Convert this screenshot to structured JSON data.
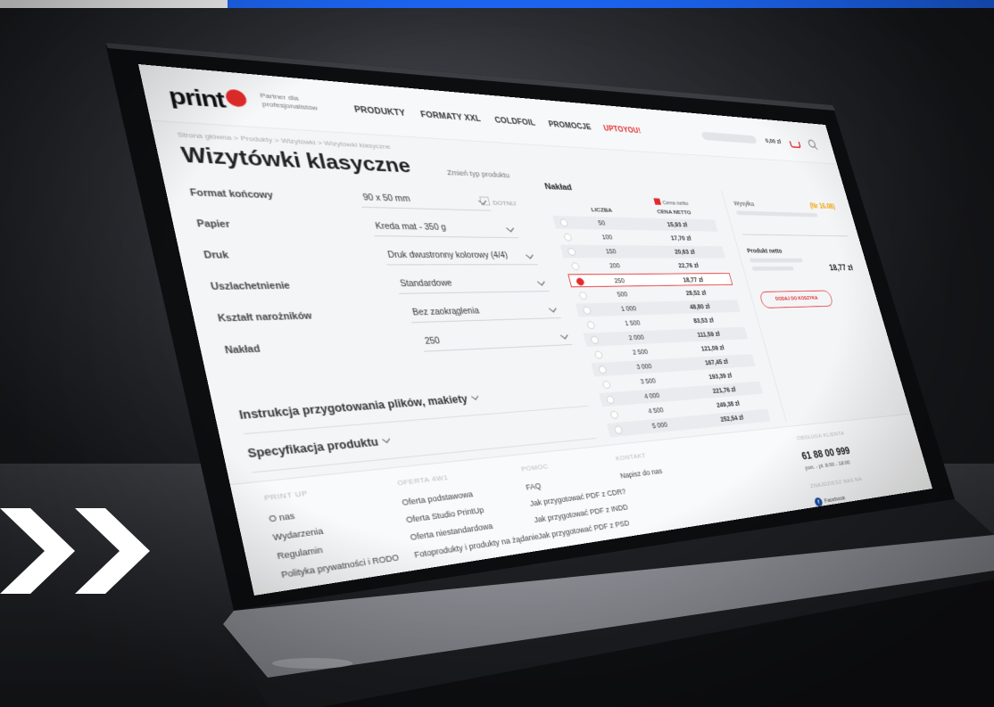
{
  "brand": {
    "logo": "print",
    "tagline": "Partner dla profesjonalistów",
    "accent": "#e32b2b",
    "strip_blue": "#1e6bff"
  },
  "nav": {
    "items": [
      "PRODUKTY",
      "FORMATY XXL",
      "COLDFOIL",
      "PROMOCJE"
    ],
    "highlight": "UPTOYOU!"
  },
  "header": {
    "cart_total": "0,00 zł",
    "icons": [
      "cart-icon",
      "search-icon"
    ]
  },
  "page": {
    "breadcrumbs": "Strona główna > Produkty > Wizytówki > Wizytówki klasyczne",
    "title": "Wizytówki klasyczne",
    "change_type": "Zmień typ produktu"
  },
  "form": {
    "rows": [
      {
        "label": "Format końcowy",
        "value": "90 x 50 mm"
      },
      {
        "label": "Papier",
        "value": "Kreda mat - 350 g"
      },
      {
        "label": "Druk",
        "value": "Druk dwustronny kolorowy (4/4)"
      },
      {
        "label": "Uszlachetnienie",
        "value": "Standardowe"
      },
      {
        "label": "Kształt narożników",
        "value": "Bez zaokrąglenia"
      },
      {
        "label": "Nakład",
        "value": "250"
      }
    ],
    "dotnij_label": "DOTNIJ"
  },
  "accordions": {
    "instructions": "Instrukcja przygotowania plików, makiety",
    "spec": "Specyfikacja produktu"
  },
  "naklad": {
    "title": "Nakład",
    "cena_netto_label": "Cena netto",
    "col_qty": "LICZBA",
    "col_price": "CENA NETTO",
    "selected_index": 4,
    "rows": [
      {
        "qty": "50",
        "price": "15,93 zł"
      },
      {
        "qty": "100",
        "price": "17,70 zł"
      },
      {
        "qty": "150",
        "price": "20,63 zł"
      },
      {
        "qty": "200",
        "price": "22,76 zł"
      },
      {
        "qty": "250",
        "price": "18,77 zł"
      },
      {
        "qty": "500",
        "price": "28,52 zł"
      },
      {
        "qty": "1 000",
        "price": "48,80 zł"
      },
      {
        "qty": "1 500",
        "price": "83,53 zł"
      },
      {
        "qty": "2 000",
        "price": "111,59 zł"
      },
      {
        "qty": "2 500",
        "price": "121,09 zł"
      },
      {
        "qty": "3 000",
        "price": "167,45 zł"
      },
      {
        "qty": "3 500",
        "price": "193,39 zł"
      },
      {
        "qty": "4 000",
        "price": "221,76 zł"
      },
      {
        "qty": "4 500",
        "price": "249,38 zł"
      },
      {
        "qty": "5 000",
        "price": "252,54 zł"
      }
    ]
  },
  "summary": {
    "shipping_label": "Wysyłka",
    "shipping_price": "(Nr 16.08)",
    "netto_label": "Produkt netto",
    "netto_value": "18,77 zł",
    "add_button": "DODAJ DO KOSZYKA"
  },
  "footer": {
    "columns": [
      {
        "heading": "PRINT UP",
        "items": [
          "O nas",
          "Wydarzenia",
          "Regulamin",
          "Polityka prywatności i RODO"
        ]
      },
      {
        "heading": "OFERTA 4W1",
        "items": [
          "Oferta podstawowa",
          "Oferta Studio PrintUp",
          "Oferta niestandardowa",
          "Fotoprodukty i produkty na żądanie"
        ]
      },
      {
        "heading": "POMOC",
        "items": [
          "FAQ",
          "Jak przygotować PDF z CDR?",
          "Jak przygotować PDF z INDD",
          "Jak przygotować PDF z PSD"
        ]
      },
      {
        "heading": "KONTAKT",
        "items": [
          "Napisz do nas"
        ]
      }
    ],
    "support_heading": "OBSŁUGA KLIENTA",
    "phone": "61 88 00 999",
    "hours": "pon. - pt. 8:00 - 18:00",
    "social_heading": "ZNAJDZIESZ NAS NA",
    "facebook": "Facebook"
  }
}
